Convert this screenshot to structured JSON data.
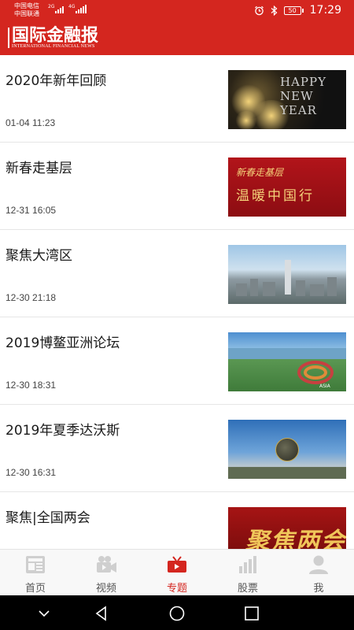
{
  "status_bar": {
    "carrier_1": "中国电信",
    "carrier_2": "中国联通",
    "network_1": "2G",
    "network_2": "4G",
    "battery": "50",
    "time": "17:29",
    "icons": [
      "alarm-icon",
      "bluetooth-icon",
      "battery-icon"
    ]
  },
  "header": {
    "brand_name": "国际金融报",
    "brand_en": "INTERNATIONAL FINANCIAL NEWS"
  },
  "topics": [
    {
      "title": "2020年新年回顾",
      "time": "01-04 11:23",
      "thumb_text": "HAPPY NEW YEAR"
    },
    {
      "title": "新春走基层",
      "time": "12-31 16:05",
      "thumb_text_1": "新春走基层",
      "thumb_text_2": "温暖中国行"
    },
    {
      "title": "聚焦大湾区",
      "time": "12-30 21:18"
    },
    {
      "title": "2019博鳌亚洲论坛",
      "time": "12-30 18:31",
      "thumb_text": "ASIA"
    },
    {
      "title": "2019年夏季达沃斯",
      "time": "12-30 16:31"
    },
    {
      "title": "聚焦|全国两会",
      "time": "",
      "thumb_text": "聚焦两会"
    }
  ],
  "tabs": [
    {
      "label": "首页",
      "icon": "newspaper-icon"
    },
    {
      "label": "视频",
      "icon": "video-camera-icon"
    },
    {
      "label": "专题",
      "icon": "tv-icon",
      "active": true
    },
    {
      "label": "股票",
      "icon": "bar-chart-icon"
    },
    {
      "label": "我",
      "icon": "user-icon"
    }
  ],
  "colors": {
    "brand_red": "#d4261f",
    "tab_inactive": "#555555",
    "tab_active": "#d4261f"
  }
}
